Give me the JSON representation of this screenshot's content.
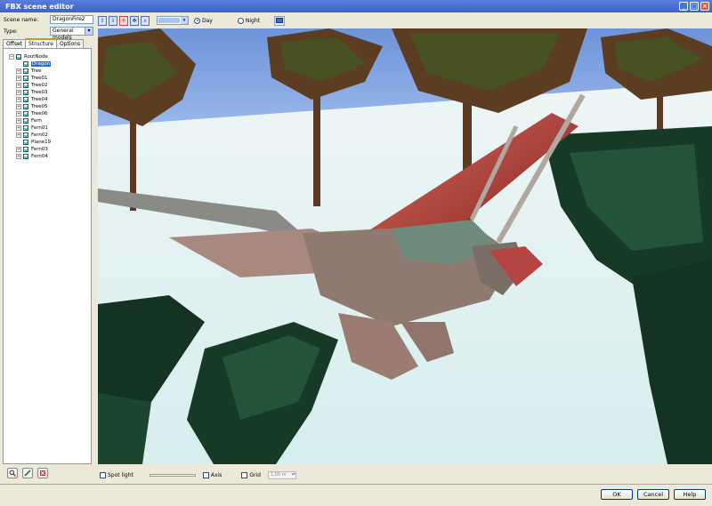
{
  "window": {
    "title": "FBX scene editor"
  },
  "scene": {
    "name_label": "Scene name:",
    "name_value": "DragonFire2",
    "type_label": "Type:",
    "type_value": "General models"
  },
  "tabs": [
    {
      "label": "Offset"
    },
    {
      "label": "Structure"
    },
    {
      "label": "Options"
    }
  ],
  "tree": {
    "root": "RootNode",
    "items": [
      {
        "label": "Dragon"
      },
      {
        "label": "Tree"
      },
      {
        "label": "Tree01"
      },
      {
        "label": "Tree02"
      },
      {
        "label": "Tree03"
      },
      {
        "label": "Tree04"
      },
      {
        "label": "Tree05"
      },
      {
        "label": "Tree06"
      },
      {
        "label": "Fern"
      },
      {
        "label": "Fern01"
      },
      {
        "label": "Fern02"
      },
      {
        "label": "Plane19"
      },
      {
        "label": "Fern03"
      },
      {
        "label": "Fern04"
      }
    ]
  },
  "toolbar": {
    "day_label": "Day",
    "night_label": "Night"
  },
  "viewport_options": {
    "spotlight_label": "Spot light",
    "axis_label": "Axis",
    "grid_label": "Grid",
    "grid_size": "1,00 m"
  },
  "footer": {
    "ok_label": "OK",
    "cancel_label": "Cancel",
    "help_label": "Help"
  }
}
